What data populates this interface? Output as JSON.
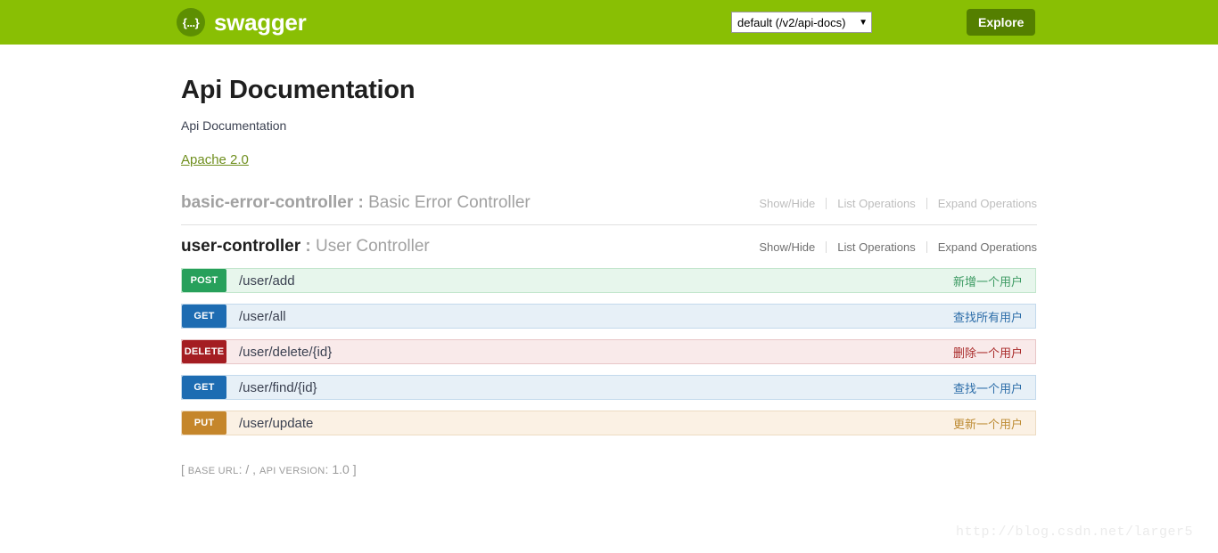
{
  "topbar": {
    "brand_name": "swagger",
    "logo_glyph": "{...}",
    "api_select_value": "default (/v2/api-docs)",
    "caret_glyph": "▼",
    "explore_label": "Explore"
  },
  "info": {
    "title": "Api Documentation",
    "description": "Api Documentation",
    "license_label": "Apache 2.0",
    "footer_open": "[",
    "footer_base_url_label": "base url",
    "footer_base_url_sep": ":",
    "footer_base_url_value": "/",
    "footer_comma": ",",
    "footer_api_version_label": "api version",
    "footer_api_version_sep": ":",
    "footer_api_version_value": "1.0",
    "footer_close": "]"
  },
  "resources": [
    {
      "name": "basic-error-controller",
      "separator": ":",
      "description": "Basic Error Controller",
      "options": [
        "Show/Hide",
        "List Operations",
        "Expand Operations"
      ],
      "operations": []
    },
    {
      "name": "user-controller",
      "separator": ":",
      "description": "User Controller",
      "options": [
        "Show/Hide",
        "List Operations",
        "Expand Operations"
      ],
      "operations": [
        {
          "method": "POST",
          "method_class": "post",
          "path": "/user/add",
          "summary": "新增一个用户"
        },
        {
          "method": "GET",
          "method_class": "get",
          "path": "/user/all",
          "summary": "查找所有用户"
        },
        {
          "method": "DELETE",
          "method_class": "delete",
          "path": "/user/delete/{id}",
          "summary": "删除一个用户"
        },
        {
          "method": "GET",
          "method_class": "get",
          "path": "/user/find/{id}",
          "summary": "查找一个用户"
        },
        {
          "method": "PUT",
          "method_class": "put",
          "path": "/user/update",
          "summary": "更新一个用户"
        }
      ]
    }
  ],
  "watermark": {
    "text": "http://blog.csdn.net/larger5"
  },
  "colors": {
    "header_green": "#89bf04",
    "explore_green": "#547f00",
    "link_green": "#6f8f1e",
    "post": "#27a05b",
    "get": "#1d6cb2",
    "delete": "#a41d22",
    "put": "#c5862b"
  }
}
